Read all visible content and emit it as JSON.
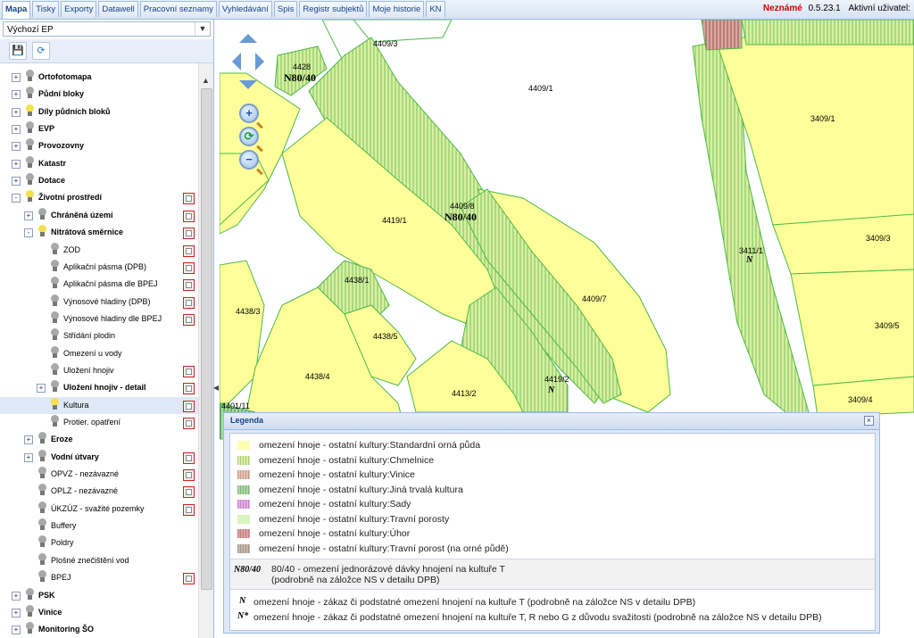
{
  "tabs": [
    "Mapa",
    "Tisky",
    "Exporty",
    "Datawell",
    "Pracovní seznamy",
    "Vyhledávání",
    "Spis",
    "Registr subjektů",
    "Moje historie",
    "KN"
  ],
  "status": {
    "unknown": "Neznámé",
    "version": "0.5.23.1",
    "user_label": "Aktivní uživatel:"
  },
  "profile": {
    "selected": "Výchozí EP"
  },
  "toolbar": {
    "save_icon": "save-icon",
    "refresh_icon": "refresh-icon"
  },
  "tree": [
    {
      "label": "Ortofotomapa",
      "bold": true,
      "expand": "+",
      "level": 0,
      "bulb": "off",
      "legend": false
    },
    {
      "label": "Půdní bloky",
      "bold": true,
      "expand": "+",
      "level": 0,
      "bulb": "off",
      "legend": false
    },
    {
      "label": "Díly půdních bloků",
      "bold": true,
      "expand": "+",
      "level": 0,
      "bulb": "on",
      "legend": false
    },
    {
      "label": "EVP",
      "bold": true,
      "expand": "+",
      "level": 0,
      "bulb": "off",
      "legend": false
    },
    {
      "label": "Provozovny",
      "bold": true,
      "expand": "+",
      "level": 0,
      "bulb": "off",
      "legend": false
    },
    {
      "label": "Katastr",
      "bold": true,
      "expand": "+",
      "level": 0,
      "bulb": "off",
      "legend": false
    },
    {
      "label": "Dotace",
      "bold": true,
      "expand": "+",
      "level": 0,
      "bulb": "off",
      "legend": false
    },
    {
      "label": "Životní prostředí",
      "bold": true,
      "expand": "-",
      "level": 0,
      "bulb": "on",
      "legend": true
    },
    {
      "label": "Chráněná území",
      "bold": true,
      "expand": "+",
      "level": 1,
      "bulb": "off",
      "legend": true
    },
    {
      "label": "Nitrátová směrnice",
      "bold": true,
      "expand": "-",
      "level": 1,
      "bulb": "on",
      "legend": true
    },
    {
      "label": "ZOD",
      "bold": false,
      "expand": "",
      "level": 2,
      "bulb": "off",
      "legend": true
    },
    {
      "label": "Aplikační pásma (DPB)",
      "bold": false,
      "expand": "",
      "level": 2,
      "bulb": "off",
      "legend": true
    },
    {
      "label": "Aplikační pásma dle BPEJ",
      "bold": false,
      "expand": "",
      "level": 2,
      "bulb": "off",
      "legend": true
    },
    {
      "label": "Výnosové hladiny (DPB)",
      "bold": false,
      "expand": "",
      "level": 2,
      "bulb": "off",
      "legend": true
    },
    {
      "label": "Výnosové hladiny dle BPEJ",
      "bold": false,
      "expand": "",
      "level": 2,
      "bulb": "off",
      "legend": true
    },
    {
      "label": "Střídání plodin",
      "bold": false,
      "expand": "",
      "level": 2,
      "bulb": "off",
      "legend": false
    },
    {
      "label": "Omezení u vody",
      "bold": false,
      "expand": "",
      "level": 2,
      "bulb": "off",
      "legend": false
    },
    {
      "label": "Uložení hnojiv",
      "bold": false,
      "expand": "",
      "level": 2,
      "bulb": "off",
      "legend": true
    },
    {
      "label": "Uložení hnojiv - detail",
      "bold": true,
      "expand": "+",
      "level": 2,
      "bulb": "off",
      "legend": true
    },
    {
      "label": "Kultura",
      "bold": false,
      "expand": "",
      "level": 2,
      "bulb": "on",
      "legend": true,
      "selected": true
    },
    {
      "label": "Protier. opatření",
      "bold": false,
      "expand": "",
      "level": 2,
      "bulb": "off",
      "legend": true
    },
    {
      "label": "Eroze",
      "bold": true,
      "expand": "+",
      "level": 1,
      "bulb": "off",
      "legend": false
    },
    {
      "label": "Vodní útvary",
      "bold": true,
      "expand": "+",
      "level": 1,
      "bulb": "off",
      "legend": true
    },
    {
      "label": "OPVZ - nezávazné",
      "bold": false,
      "expand": "",
      "level": 1,
      "bulb": "off",
      "legend": true
    },
    {
      "label": "OPLZ - nezávazné",
      "bold": false,
      "expand": "",
      "level": 1,
      "bulb": "off",
      "legend": true
    },
    {
      "label": "ÚKZÚZ - svažité pozemky",
      "bold": false,
      "expand": "",
      "level": 1,
      "bulb": "off",
      "legend": true
    },
    {
      "label": "Buffery",
      "bold": false,
      "expand": "",
      "level": 1,
      "bulb": "off",
      "legend": false
    },
    {
      "label": "Poldry",
      "bold": false,
      "expand": "",
      "level": 1,
      "bulb": "off",
      "legend": false
    },
    {
      "label": "Plošné znečištění vod",
      "bold": false,
      "expand": "",
      "level": 1,
      "bulb": "off",
      "legend": false
    },
    {
      "label": "BPEJ",
      "bold": false,
      "expand": "",
      "level": 1,
      "bulb": "off",
      "legend": true
    },
    {
      "label": "PSK",
      "bold": true,
      "expand": "+",
      "level": 0,
      "bulb": "off",
      "legend": false
    },
    {
      "label": "Vinice",
      "bold": true,
      "expand": "+",
      "level": 0,
      "bulb": "off",
      "legend": false
    },
    {
      "label": "Monitoring ŠO",
      "bold": true,
      "expand": "+",
      "level": 0,
      "bulb": "off",
      "legend": false
    }
  ],
  "map": {
    "parcels": [
      "4409/3",
      "4428",
      "4409/1",
      "3409/1",
      "4419/1",
      "4409/8",
      "3411/1",
      "3409/3",
      "4438/1",
      "4409/7",
      "4438/3",
      "4438/5",
      "3409/5",
      "4438/4",
      "4419/2",
      "4413/2",
      "3409/4",
      "4401/11"
    ],
    "nitrate_labels": [
      "N80/40",
      "N80/40"
    ]
  },
  "legend": {
    "title": "Legenda",
    "close": "×",
    "items": [
      {
        "text": "omezení hnoje - ostatní kultury:Standardní orná půda",
        "color": "#ffffb0"
      },
      {
        "text": "omezení hnoje - ostatní kultury:Chmelnice",
        "color": "#d8f0a0"
      },
      {
        "text": "omezení hnoje - ostatní kultury:Vinice",
        "color": "#e8c0b0"
      },
      {
        "text": "omezení hnoje - ostatní kultury:Jiná trvalá kultura",
        "color": "#a8d8a0"
      },
      {
        "text": "omezení hnoje - ostatní kultury:Sady",
        "color": "#e8a8e8"
      },
      {
        "text": "omezení hnoje - ostatní kultury:Travní porosty",
        "color": "#d8f5c0"
      },
      {
        "text": "omezení hnoje - ostatní kultury:Úhor",
        "color": "#e0a0a0"
      },
      {
        "text": "omezení hnoje - ostatní kultury:Travní porost (na orné půdě)",
        "color": "#c8b8a8"
      }
    ],
    "dose_symbol": "N80/40",
    "dose_text_1": "80/40 - omezení jednorázové dávky hnojení na kultuře T",
    "dose_text_2": "(podrobně na záložce NS v detailu DPB)",
    "ban_symbol_1": "N",
    "ban_text_1": "omezení hnoje - zákaz či podstatné omezení hnojení na kultuře T (podrobně na záložce NS v detailu DPB)",
    "ban_symbol_2": "N*",
    "ban_text_2": "omezení hnoje - zákaz či podstatné omezení hnojení na kultuře T, R nebo G z důvodu svažitosti (podrobně na záložce NS v detailu DPB)"
  }
}
